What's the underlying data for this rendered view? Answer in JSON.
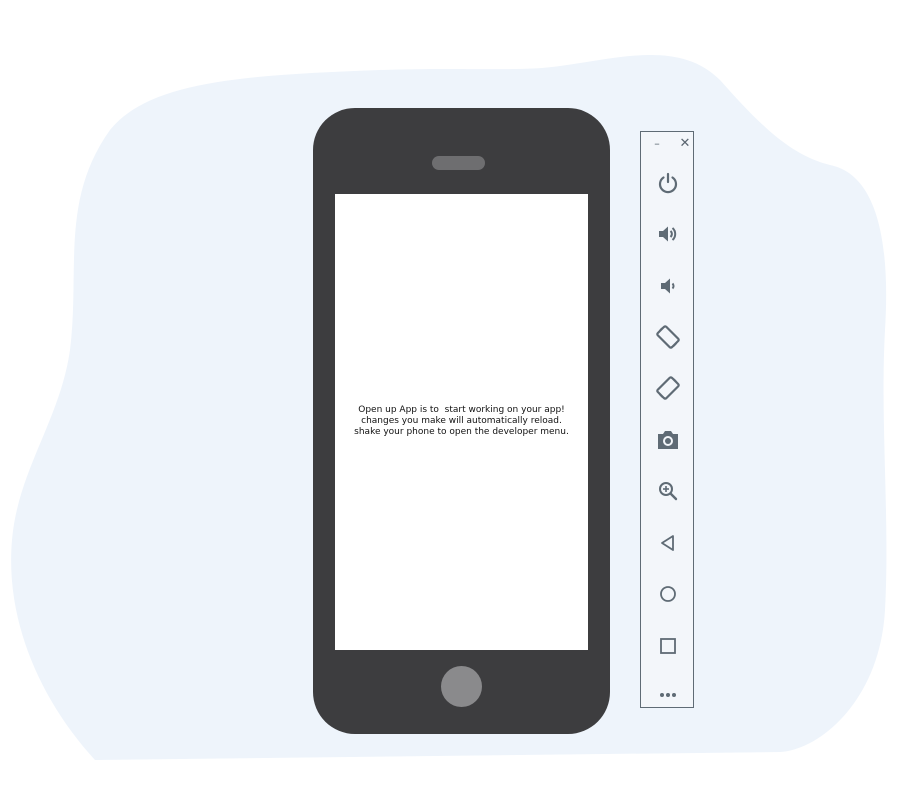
{
  "app": {
    "screen_lines": [
      "Open up App is to  start working on your app!",
      "changes you make will automatically reload.",
      "shake your phone to open the developer menu."
    ]
  },
  "window_controls": {
    "minimize_label": "–",
    "close_label": "✕"
  },
  "toolbar": {
    "icon_color": "#5f6b75",
    "items": [
      {
        "icon": "power-icon"
      },
      {
        "icon": "volume-up-icon"
      },
      {
        "icon": "volume-down-icon"
      },
      {
        "icon": "rotate-left-icon"
      },
      {
        "icon": "rotate-right-icon"
      },
      {
        "icon": "camera-icon"
      },
      {
        "icon": "zoom-in-icon"
      },
      {
        "icon": "back-icon"
      },
      {
        "icon": "home-icon"
      },
      {
        "icon": "overview-icon"
      },
      {
        "icon": "more-icon"
      }
    ]
  },
  "colors": {
    "background_blob": "#eef4fb",
    "phone_body": "#3d3d3f",
    "screen": "#ffffff",
    "toolbar_bg": "#f3f6fa"
  }
}
